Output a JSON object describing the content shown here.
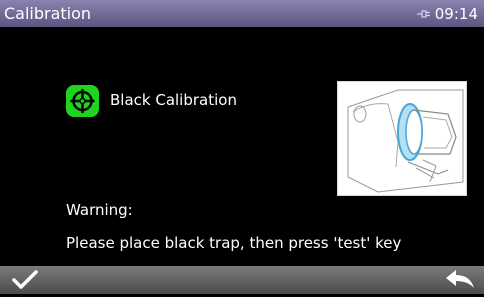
{
  "header": {
    "title": "Calibration",
    "status_icon": "plug-icon",
    "time": "09:14"
  },
  "main": {
    "calibration_title": "Black Calibration",
    "calibration_icon": "crosshair-target-icon",
    "image": "instrument-aperture-illustration",
    "warning_label": "Warning:",
    "warning_message": "Please place black trap, then press 'test' key"
  },
  "footer": {
    "confirm_icon": "checkmark-icon",
    "back_icon": "back-arrow-icon"
  },
  "colors": {
    "title_bar": "#6f6a98",
    "accent_green": "#1fd31f",
    "bottom_bar": "#5a5a5a"
  }
}
